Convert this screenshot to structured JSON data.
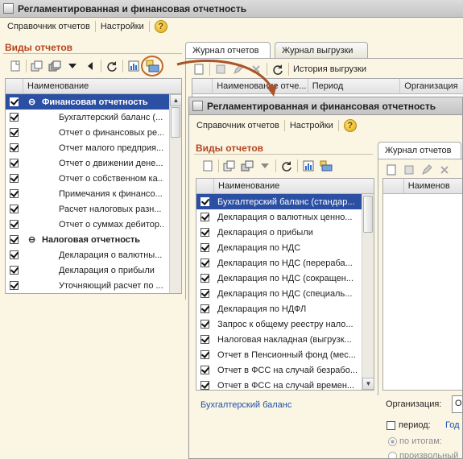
{
  "window": {
    "title": "Регламентированная и финансовая отчетность"
  },
  "menu": {
    "items": [
      "Справочник отчетов",
      "Настройки"
    ],
    "help": "?"
  },
  "left": {
    "section_title": "Виды отчетов",
    "column": "Наименование",
    "rows": [
      {
        "text": "Финансовая  отчетность",
        "group": true,
        "selected": true
      },
      {
        "text": "Бухгалтерский баланс (..."
      },
      {
        "text": "Отчет о финансовых ре..."
      },
      {
        "text": "Отчет малого предприя..."
      },
      {
        "text": "Отчет о движении дене..."
      },
      {
        "text": "Отчет о собственном ка..."
      },
      {
        "text": "Примечания к финансо..."
      },
      {
        "text": "Расчет налоговых разн..."
      },
      {
        "text": "Отчет о суммах дебитор..."
      },
      {
        "text": "Налоговая отчетность",
        "group": true
      },
      {
        "text": "Декларация о валютны..."
      },
      {
        "text": "Декларация о прибыли"
      },
      {
        "text": "Уточняющий расчет по ..."
      }
    ]
  },
  "right": {
    "tabs": [
      "Журнал отчетов",
      "Журнал выгрузки"
    ],
    "history": "История выгрузки",
    "columns": [
      "Наименование отче...",
      "Период",
      "Организация"
    ]
  },
  "popup": {
    "title": "Регламентированная и финансовая отчетность",
    "menu": [
      "Справочник отчетов",
      "Настройки"
    ],
    "help": "?",
    "section_title": "Виды отчетов",
    "column": "Наименование",
    "rows": [
      "Бухгалтерский баланс (стандар...",
      "Декларация о валютных ценно...",
      "Декларация о прибыли",
      "Декларация по НДС",
      "Декларация по НДС (перераба...",
      "Декларация по НДС (сокращен...",
      "Декларация по НДС (специаль...",
      "Декларация по НДФЛ",
      "Запрос к общему реестру нало...",
      "Налоговая накладная (выгрузк...",
      "Отчет в Пенсионный фонд (мес...",
      "Отчет в ФСС на случай безрабо...",
      "Отчет в ФСС на случай времен..."
    ],
    "footer_link": "Бухгалтерский баланс",
    "tab": "Журнал отчетов",
    "grid_column": "Наименов",
    "org_label": "Организация:",
    "org_value": "О",
    "period_label": "период:",
    "year_value": "Год",
    "radio1": "по итогам:",
    "radio2": "произвольный"
  },
  "colors": {
    "accent": "#b5441e",
    "selection": "#2b4fa3",
    "link": "#1b4fa8",
    "highlight_ring": "#c0682a"
  }
}
